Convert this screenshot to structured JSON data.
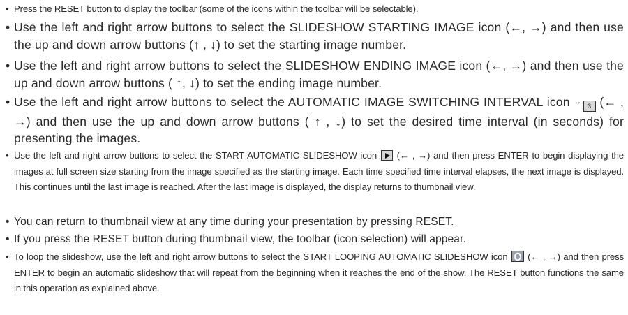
{
  "instructions": [
    {
      "size": "sm",
      "text": "Press the RESET button to display the toolbar (some of the icons within the toolbar will be selectable)."
    },
    {
      "size": "lg",
      "text": "Use the left and right arrow buttons to select the SLIDESHOW STARTING IMAGE icon (←, →) and then use the up and down arrow buttons (↑ , ↓) to set the starting image number."
    },
    {
      "size": "lg",
      "text": "Use the left and right arrow buttons to select the SLIDESHOW ENDING IMAGE icon (←, →) and then use the up and down arrow buttons ( ↑, ↓) to set the ending image number."
    },
    {
      "size": "lg",
      "before": "Use the left and right arrow buttons to select the AUTOMATIC IMAGE SWITCHING INTERVAL icon ",
      "after": " (← , →) and then use the up and down arrow buttons ( ↑ , ↓) to set the desired time interval (in seconds) for presenting the images.",
      "icon": "interval-icon",
      "icon_text": "3",
      "icon_arrows": "↔"
    },
    {
      "size": "sm",
      "before": "Use the left and right arrow buttons to select the START AUTOMATIC SLIDESHOW icon ",
      "after": " (← , →) and then press ENTER to begin displaying the images at full screen size starting from the image specified as the starting image. Each time specified time interval elapses, the next image is displayed. This continues until the last image is reached. After the last image is displayed, the display returns to thumbnail view.",
      "icon": "play-icon"
    },
    {
      "size": "md",
      "text": "You can return to thumbnail view at any time during your presentation by pressing RESET."
    },
    {
      "size": "md",
      "text": "If you press the RESET button during thumbnail view, the toolbar (icon selection) will appear."
    },
    {
      "size": "sm",
      "before": "To loop the slideshow, use the left and right arrow buttons to select the START LOOPING AUTOMATIC SLIDESHOW icon ",
      "after": " (← , →) and then press ENTER to begin an automatic slideshow that will repeat from the beginning when it reaches the end of the show. The RESET button functions the same in this operation as explained above.",
      "icon": "loop-icon"
    }
  ]
}
